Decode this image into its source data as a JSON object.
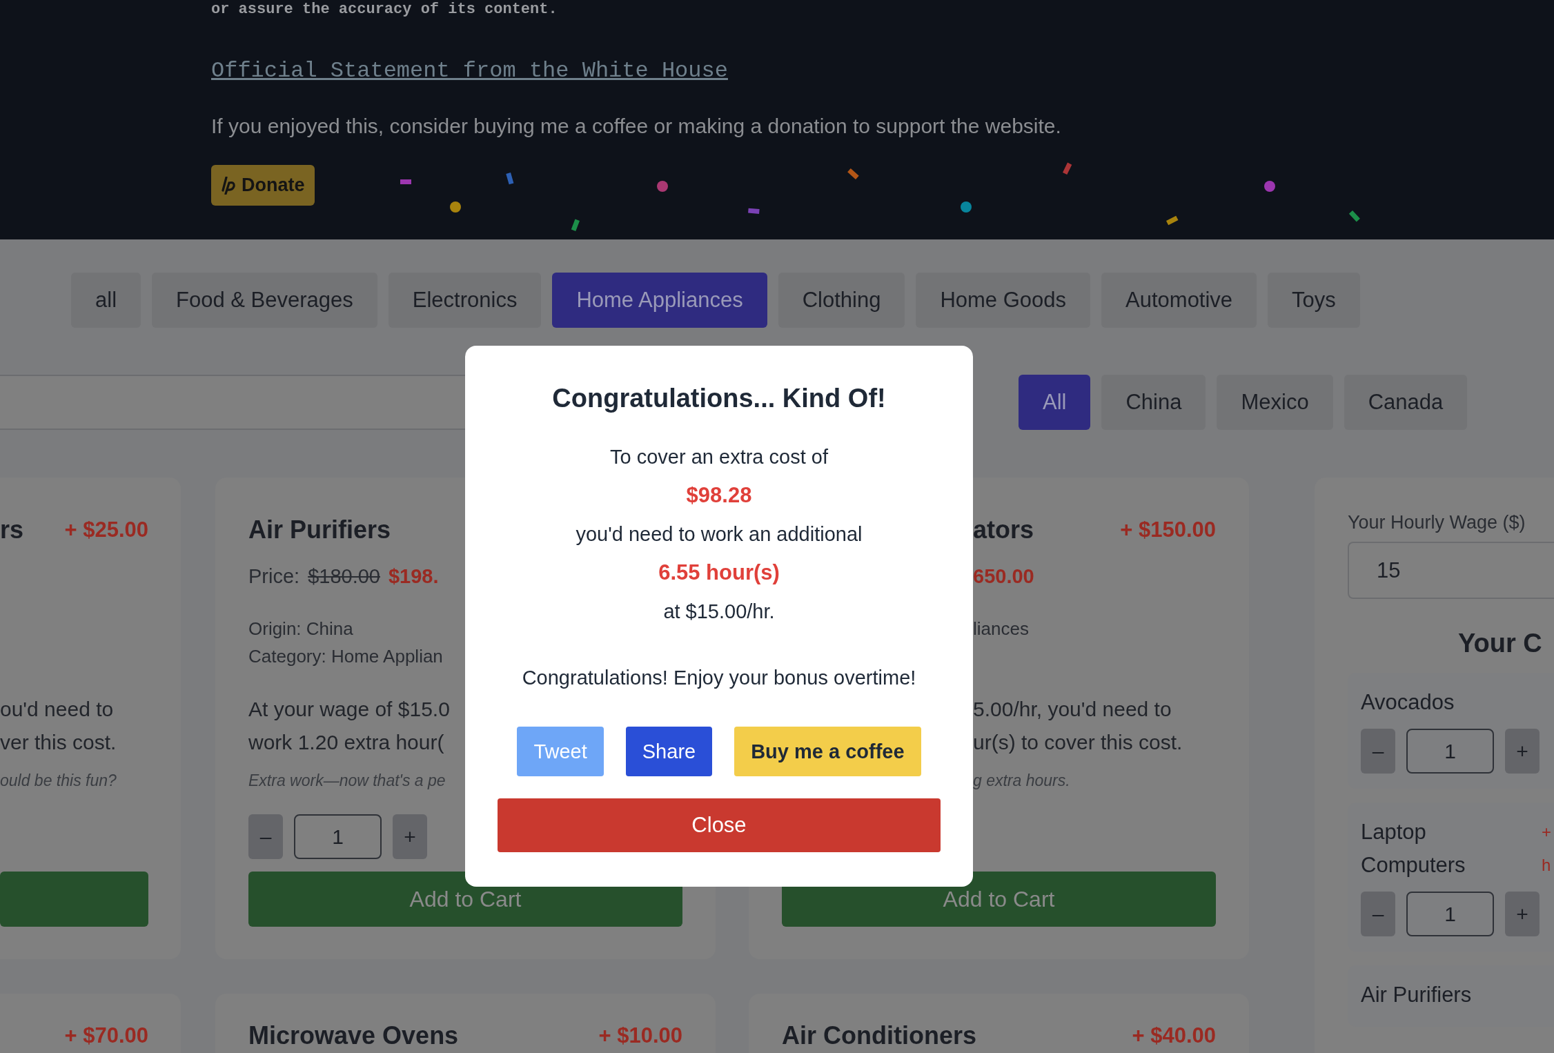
{
  "header": {
    "notice_tail": "or assure the accuracy of its content.",
    "link": "Official Statement from the White House",
    "appeal": "If you enjoyed this, consider buying me a coffee or making a donation to support the website.",
    "donate_button": "Donate"
  },
  "category_tabs": [
    {
      "label": "all",
      "selected": false
    },
    {
      "label": "Food & Beverages",
      "selected": false
    },
    {
      "label": "Electronics",
      "selected": false
    },
    {
      "label": "Home Appliances",
      "selected": true
    },
    {
      "label": "Clothing",
      "selected": false
    },
    {
      "label": "Home Goods",
      "selected": false
    },
    {
      "label": "Automotive",
      "selected": false
    },
    {
      "label": "Toys",
      "selected": false
    }
  ],
  "origin_filters": [
    {
      "label": "All",
      "selected": true
    },
    {
      "label": "China",
      "selected": false
    },
    {
      "label": "Mexico",
      "selected": false
    },
    {
      "label": "Canada",
      "selected": false
    }
  ],
  "products": [
    {
      "kind": "left_cut",
      "title": "rs",
      "surcharge": "+ $25.00",
      "body": [
        "ou'd need to",
        "ver this cost."
      ],
      "note": "ould be this fun?"
    },
    {
      "kind": "full",
      "title": "Air Purifiers",
      "price_label": "Price:",
      "old_price": "$180.00",
      "new_price": "$198.",
      "meta": [
        "Origin: China",
        "Category: Home Applian"
      ],
      "body": [
        "At your wage of $15.0",
        "work 1.20 extra hour("
      ],
      "note": "Extra work—now that's a pe",
      "quantity": {
        "minus": "–",
        "value": "1",
        "plus": "+"
      },
      "button": "Add to Cart"
    },
    {
      "kind": "right_cut",
      "title": "ators",
      "surcharge": "+ $150.00",
      "new_price": "650.00",
      "meta": [
        "liances"
      ],
      "body": [
        "5.00/hr, you'd need to",
        "ur(s) to cover this cost."
      ],
      "note": "g extra hours.",
      "button": "Add to Cart"
    }
  ],
  "more_products": [
    {
      "kind": "left_cut",
      "surcharge": "+ $70.00"
    },
    {
      "kind": "full",
      "title": "Microwave Ovens",
      "surcharge": "+ $10.00"
    },
    {
      "kind": "full",
      "title": "Air Conditioners",
      "surcharge": "+ $40.00"
    }
  ],
  "wage_panel": {
    "label": "Your Hourly Wage ($)",
    "value": "15",
    "cart_heading": "Your C",
    "items": [
      {
        "name": "Avocados",
        "quantity": {
          "minus": "–",
          "value": "1",
          "plus": "+"
        }
      },
      {
        "name": "Laptop Computers",
        "side": [
          "+",
          "h"
        ],
        "quantity": {
          "minus": "–",
          "value": "1",
          "plus": "+"
        }
      },
      {
        "name": "Air Purifiers"
      }
    ]
  },
  "modal": {
    "title": "Congratulations... Kind Of!",
    "lines": [
      {
        "kind": "text",
        "text": "To cover an extra cost of"
      },
      {
        "kind": "highlight",
        "text": "$98.28"
      },
      {
        "kind": "text",
        "text": "you'd need to work an additional"
      },
      {
        "kind": "highlight",
        "text": "6.55 hour(s)"
      },
      {
        "kind": "text",
        "text": "at $15.00/hr."
      }
    ],
    "closing": "Congratulations! Enjoy your bonus overtime!",
    "buttons": [
      {
        "kind": "tweet",
        "label": "Tweet"
      },
      {
        "kind": "share",
        "label": "Share"
      },
      {
        "kind": "coffee",
        "label": "Buy me a coffee"
      }
    ],
    "close_button": "Close"
  }
}
